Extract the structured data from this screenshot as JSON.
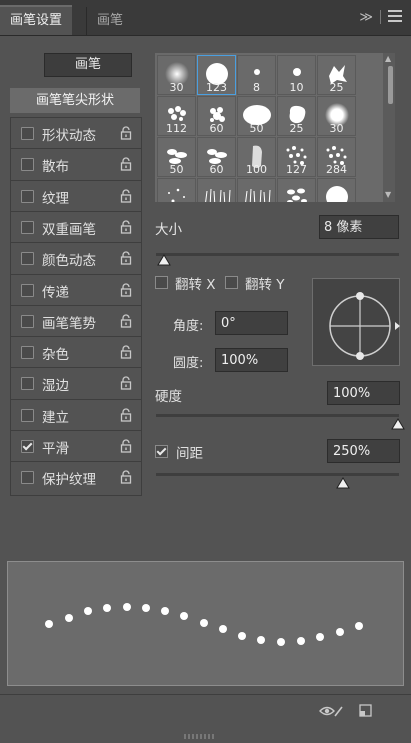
{
  "tabs": [
    {
      "label": "画笔设置",
      "active": true
    },
    {
      "label": "画笔",
      "active": false
    }
  ],
  "tabbar": {
    "collapse_glyph": "≫"
  },
  "left": {
    "brushes_button": "画笔",
    "tip_shape": "画笔笔尖形状",
    "options": [
      {
        "label": "形状动态",
        "checked": false
      },
      {
        "label": "散布",
        "checked": false
      },
      {
        "label": "纹理",
        "checked": false
      },
      {
        "label": "双重画笔",
        "checked": false
      },
      {
        "label": "颜色动态",
        "checked": false
      },
      {
        "label": "传递",
        "checked": false
      },
      {
        "label": "画笔笔势",
        "checked": false
      },
      {
        "label": "杂色",
        "checked": false
      },
      {
        "label": "湿边",
        "checked": false
      },
      {
        "label": "建立",
        "checked": false
      },
      {
        "label": "平滑",
        "checked": true
      },
      {
        "label": "保护纹理",
        "checked": false
      }
    ]
  },
  "brush_grid": {
    "rows": [
      [
        "30",
        "123",
        "8",
        "10",
        "25"
      ],
      [
        "112",
        "60",
        "50",
        "25",
        "30"
      ],
      [
        "50",
        "60",
        "100",
        "127",
        "284"
      ],
      [
        "80",
        "174",
        "175",
        "306",
        "50"
      ]
    ],
    "selected": "123"
  },
  "size": {
    "label": "大小",
    "value": "8 像素",
    "slider_fraction": 0.02
  },
  "flip": {
    "x_label": "翻转 X",
    "y_label": "翻转 Y",
    "x_checked": false,
    "y_checked": false
  },
  "angle": {
    "label": "角度:",
    "value": "0°"
  },
  "roundness": {
    "label": "圆度:",
    "value": "100%"
  },
  "hardness": {
    "label": "硬度",
    "value": "100%",
    "slider_fraction": 1.0
  },
  "spacing": {
    "label": "间距",
    "value": "250%",
    "checked": true,
    "slider_fraction": 0.76
  },
  "icons": {
    "collapse": "double-chevron-right-icon",
    "panel_menu": "hamburger-menu-icon",
    "lock": "lock-icon",
    "toggle_preview": "eye-brush-icon",
    "new_preset": "new-preset-icon"
  }
}
